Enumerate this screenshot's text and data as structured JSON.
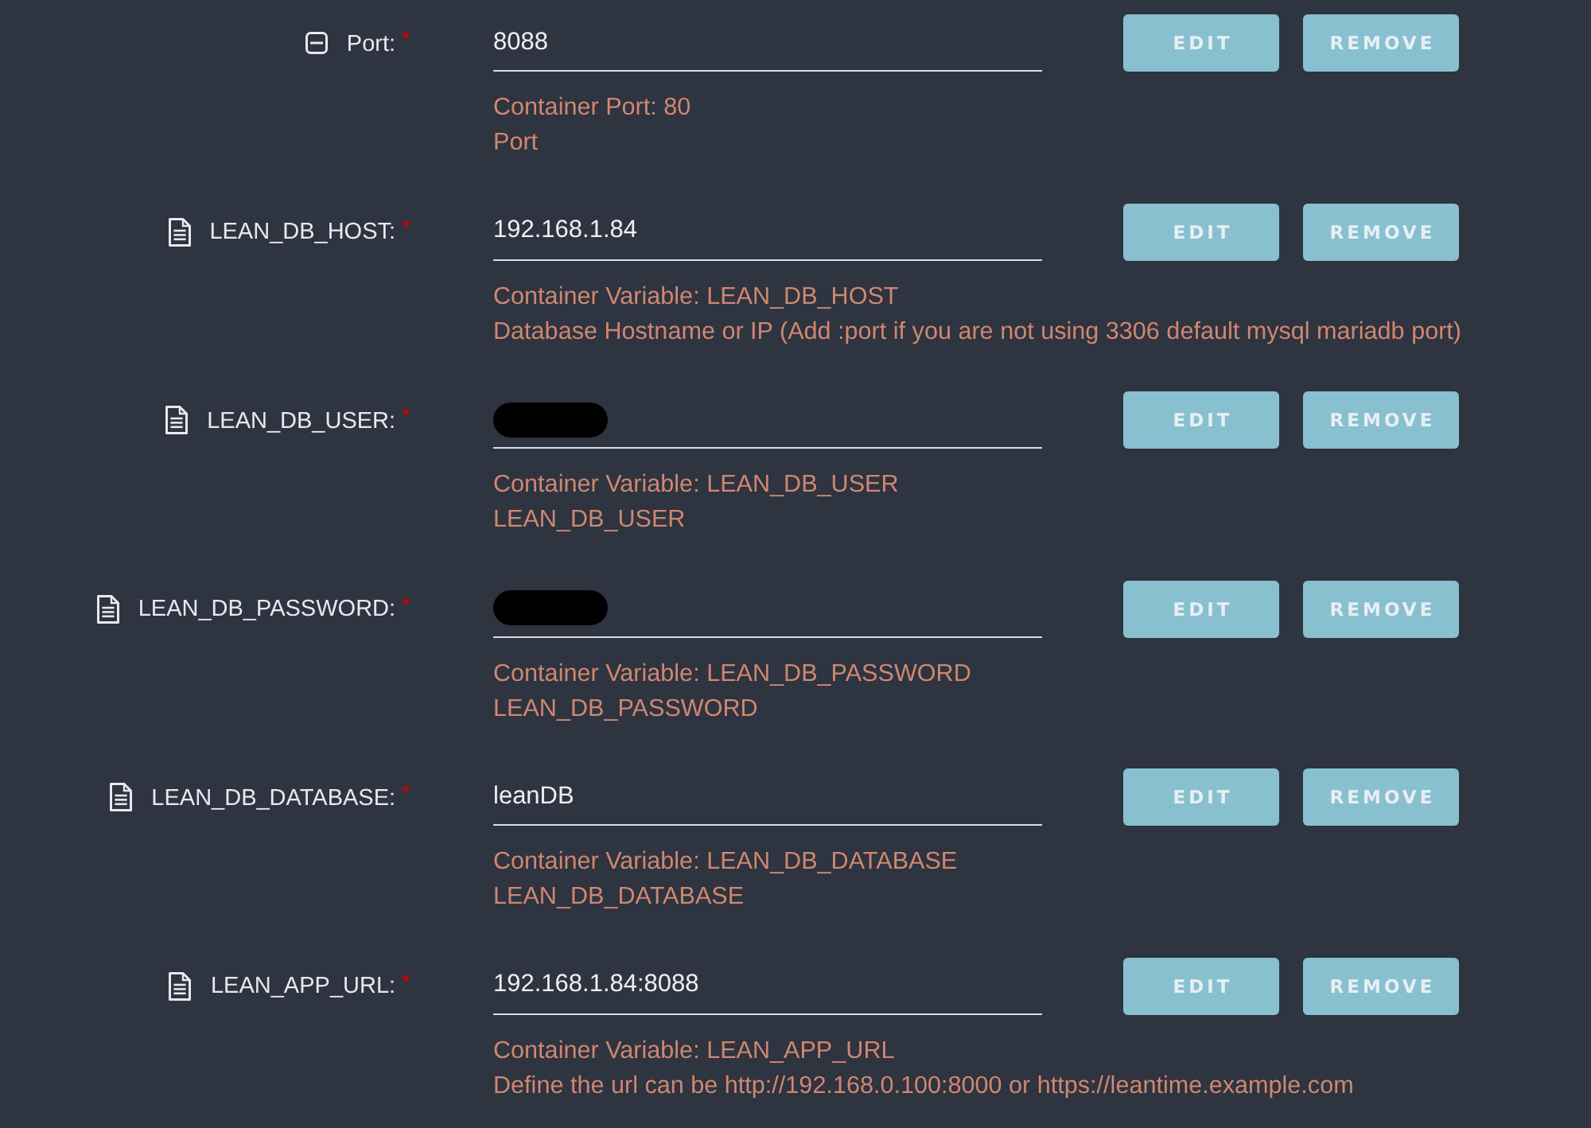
{
  "rows": [
    {
      "kind": "port",
      "label": "Port:",
      "required_mark": "*",
      "value": "8088",
      "redacted": false,
      "help": [
        "Container Port: 80",
        "Port"
      ],
      "buttons": [
        "EDIT",
        "REMOVE"
      ]
    },
    {
      "kind": "variable",
      "label": "LEAN_DB_HOST:",
      "required_mark": "*",
      "value": "192.168.1.84",
      "redacted": false,
      "help": [
        "Container Variable: LEAN_DB_HOST",
        "Database Hostname or IP (Add :port if you are not using 3306 default mysql mariadb port)"
      ],
      "buttons": [
        "EDIT",
        "REMOVE"
      ]
    },
    {
      "kind": "variable",
      "label": "LEAN_DB_USER:",
      "required_mark": "*",
      "redacted": true,
      "help": [
        "Container Variable: LEAN_DB_USER",
        "LEAN_DB_USER"
      ],
      "buttons": [
        "EDIT",
        "REMOVE"
      ]
    },
    {
      "kind": "variable",
      "label": "LEAN_DB_PASSWORD:",
      "required_mark": "*",
      "redacted": true,
      "help": [
        "Container Variable: LEAN_DB_PASSWORD",
        "LEAN_DB_PASSWORD"
      ],
      "buttons": [
        "EDIT",
        "REMOVE"
      ]
    },
    {
      "kind": "variable",
      "label": "LEAN_DB_DATABASE:",
      "required_mark": "*",
      "value": "leanDB",
      "redacted": false,
      "help": [
        "Container Variable: LEAN_DB_DATABASE",
        "LEAN_DB_DATABASE"
      ],
      "buttons": [
        "EDIT",
        "REMOVE"
      ]
    },
    {
      "kind": "variable",
      "label": "LEAN_APP_URL:",
      "required_mark": "*",
      "value": "192.168.1.84:8088",
      "redacted": false,
      "help": [
        "Container Variable: LEAN_APP_URL",
        "Define the url can be http://192.168.0.100:8000 or https://leantime.example.com"
      ],
      "buttons": [
        "EDIT",
        "REMOVE"
      ]
    }
  ]
}
